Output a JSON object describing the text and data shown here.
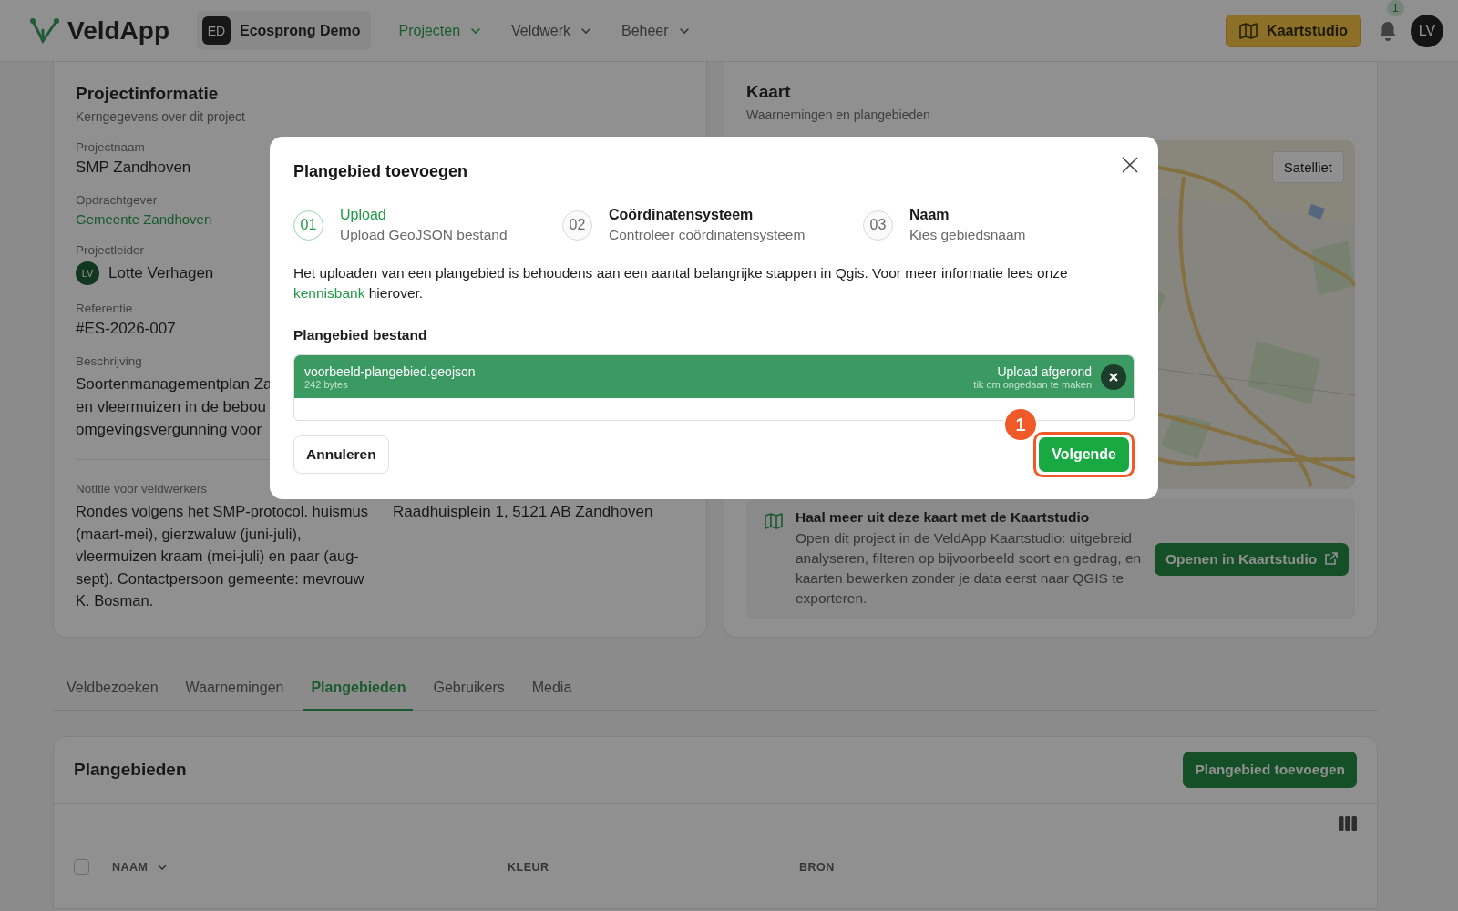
{
  "header": {
    "logo": "VeldApp",
    "org": {
      "initials": "ED",
      "name": "Ecosprong Demo"
    },
    "nav": [
      {
        "label": "Projecten",
        "selected": true
      },
      {
        "label": "Veldwerk",
        "selected": false
      },
      {
        "label": "Beheer",
        "selected": false
      }
    ],
    "studio_button": "Kaartstudio",
    "notifications": "1",
    "avatar": "LV"
  },
  "project_info": {
    "title": "Projectinformatie",
    "subtitle": "Kerngegevens over dit project",
    "fields": [
      {
        "kind": "text",
        "label": "Projectnaam",
        "value": "SMP Zandhoven"
      },
      {
        "kind": "link",
        "label": "Opdrachtgever",
        "value": "Gemeente Zandhoven"
      },
      {
        "kind": "person",
        "label": "Projectleider",
        "initials": "LV",
        "value": "Lotte Verhagen"
      },
      {
        "kind": "text",
        "label": "Referentie",
        "value": "#ES-2026-007"
      },
      {
        "kind": "lines",
        "label": "Beschrijving",
        "lines": [
          "Soortenmanagementplan Za",
          "en vleermuizen in de bebou",
          "omgevingsvergunning voor"
        ]
      }
    ],
    "note": {
      "label": "Notitie voor veldwerkers",
      "text": "Rondes volgens het SMP-protocol. huismus (maart-mei), gierzwaluw (juni-juli), vleermuizen kraam (mei-juli) en paar (aug-sept). Contactpersoon gemeente: mevrouw K. Bosman."
    },
    "address": "Raadhuisplein 1, 5121 AB Zandhoven"
  },
  "map": {
    "title": "Kaart",
    "subtitle": "Waarnemingen en plangebieden",
    "layer_button": "Satelliet",
    "promo": {
      "title": "Haal meer uit deze kaart met de Kaartstudio",
      "text": "Open dit project in de VeldApp Kaartstudio: uitgebreid analyseren, filteren op bijvoorbeeld soort en gedrag, en kaarten bewerken zonder je data eerst naar QGIS te exporteren.",
      "button": "Openen in Kaartstudio"
    }
  },
  "tabs": [
    {
      "label": "Veldbezoeken",
      "selected": false
    },
    {
      "label": "Waarnemingen",
      "selected": false
    },
    {
      "label": "Plangebieden",
      "selected": true
    },
    {
      "label": "Gebruikers",
      "selected": false
    },
    {
      "label": "Media",
      "selected": false
    }
  ],
  "panel": {
    "title": "Plangebieden",
    "add_button": "Plangebied toevoegen",
    "select_all": {
      "checked": false
    },
    "columns": [
      {
        "label": "NAAM",
        "sortable": true
      },
      {
        "label": "KLEUR",
        "sortable": false
      },
      {
        "label": "BRON",
        "sortable": false
      }
    ]
  },
  "modal": {
    "title": "Plangebied toevoegen",
    "steps": [
      {
        "number": "01",
        "title": "Upload",
        "subtitle": "Upload GeoJSON bestand",
        "selected": true
      },
      {
        "number": "02",
        "title": "Coördinatensysteem",
        "subtitle": "Controleer coördinatensysteem",
        "selected": false
      },
      {
        "number": "03",
        "title": "Naam",
        "subtitle": "Kies gebiedsnaam",
        "selected": false
      }
    ],
    "intro": "Het uploaden van een plangebied is behoudens aan een aantal belangrijke stappen in Qgis. Voor meer informatie lees onze",
    "link": "kennisbank",
    "intro_end": "hierover.",
    "file_label": "Plangebied bestand",
    "file": {
      "name": "voorbeeld-plangebied.geojson",
      "size": "242 bytes",
      "status": "Upload afgerond",
      "hint": "tik om ongedaan te maken"
    },
    "cancel": "Annuleren",
    "next": "Volgende",
    "annotation": "1"
  }
}
